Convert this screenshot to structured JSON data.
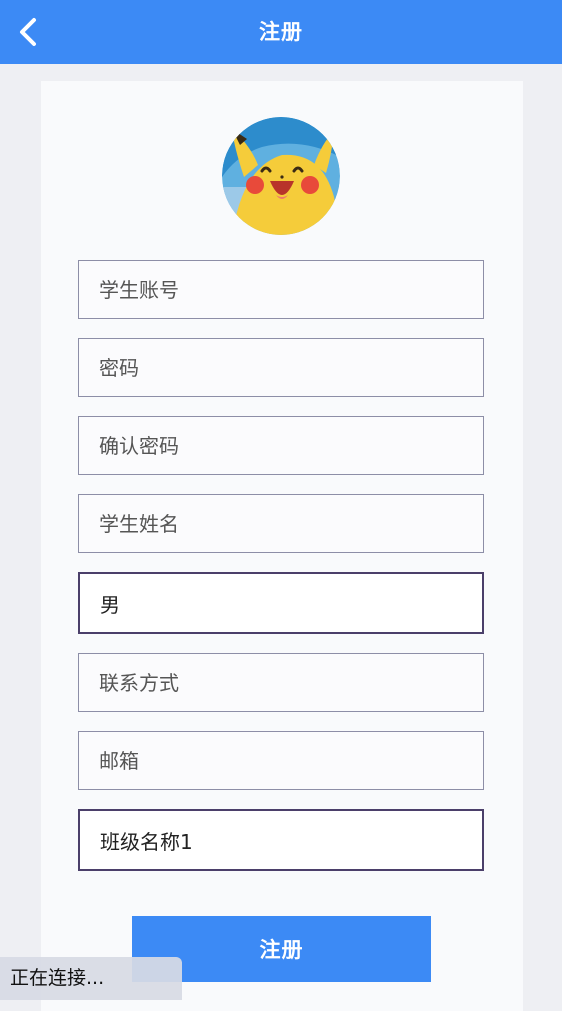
{
  "header": {
    "title": "注册",
    "back_icon": "chevron-left-icon",
    "background_color": "#3c8af5"
  },
  "avatar": {
    "icon": "pikachu-avatar"
  },
  "form": {
    "student_account_placeholder": "学生账号",
    "password_placeholder": "密码",
    "confirm_password_placeholder": "确认密码",
    "student_name_placeholder": "学生姓名",
    "gender_value": "男",
    "contact_placeholder": "联系方式",
    "email_placeholder": "邮箱",
    "class_value": "班级名称1"
  },
  "actions": {
    "register_label": "注册"
  },
  "status": {
    "text": "正在连接..."
  }
}
